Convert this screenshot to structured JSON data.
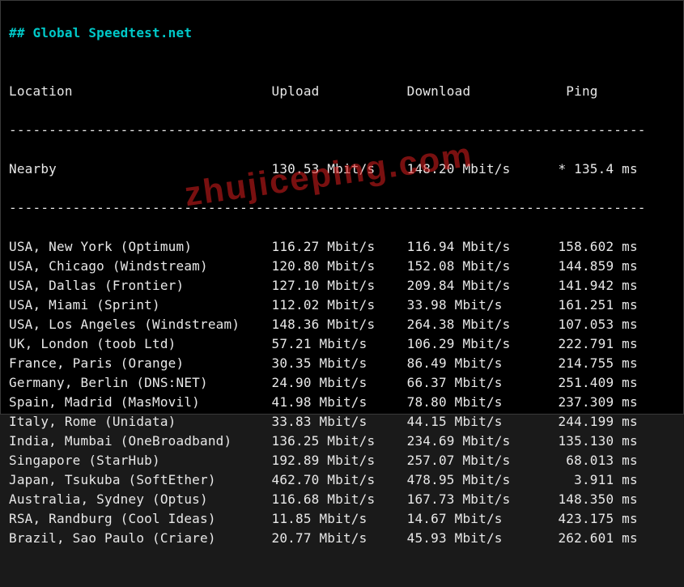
{
  "title": "## Global Speedtest.net",
  "headers": {
    "location": "Location",
    "upload": "Upload",
    "download": "Download",
    "ping": "Ping"
  },
  "separator": "--------------------------------------------------------------------------------",
  "nearby": {
    "location": "Nearby",
    "upload": "130.53 Mbit/s",
    "download": "148.20 Mbit/s",
    "ping": "* 135.4 ms"
  },
  "rows": [
    {
      "location": "USA, New York (Optimum)",
      "upload": "116.27 Mbit/s",
      "download": "116.94 Mbit/s",
      "ping": "158.602 ms"
    },
    {
      "location": "USA, Chicago (Windstream)",
      "upload": "120.80 Mbit/s",
      "download": "152.08 Mbit/s",
      "ping": "144.859 ms"
    },
    {
      "location": "USA, Dallas (Frontier)",
      "upload": "127.10 Mbit/s",
      "download": "209.84 Mbit/s",
      "ping": "141.942 ms"
    },
    {
      "location": "USA, Miami (Sprint)",
      "upload": "112.02 Mbit/s",
      "download": "33.98 Mbit/s",
      "ping": "161.251 ms"
    },
    {
      "location": "USA, Los Angeles (Windstream)",
      "upload": "148.36 Mbit/s",
      "download": "264.38 Mbit/s",
      "ping": "107.053 ms"
    },
    {
      "location": "UK, London (toob Ltd)",
      "upload": "57.21 Mbit/s",
      "download": "106.29 Mbit/s",
      "ping": "222.791 ms"
    },
    {
      "location": "France, Paris (Orange)",
      "upload": "30.35 Mbit/s",
      "download": "86.49 Mbit/s",
      "ping": "214.755 ms"
    },
    {
      "location": "Germany, Berlin (DNS:NET)",
      "upload": "24.90 Mbit/s",
      "download": "66.37 Mbit/s",
      "ping": "251.409 ms"
    },
    {
      "location": "Spain, Madrid (MasMovil)",
      "upload": "41.98 Mbit/s",
      "download": "78.80 Mbit/s",
      "ping": "237.309 ms"
    },
    {
      "location": "Italy, Rome (Unidata)",
      "upload": "33.83 Mbit/s",
      "download": "44.15 Mbit/s",
      "ping": "244.199 ms"
    },
    {
      "location": "India, Mumbai (OneBroadband)",
      "upload": "136.25 Mbit/s",
      "download": "234.69 Mbit/s",
      "ping": "135.130 ms"
    },
    {
      "location": "Singapore (StarHub)",
      "upload": "192.89 Mbit/s",
      "download": "257.07 Mbit/s",
      "ping": "68.013 ms"
    },
    {
      "location": "Japan, Tsukuba (SoftEther)",
      "upload": "462.70 Mbit/s",
      "download": "478.95 Mbit/s",
      "ping": "3.911 ms"
    },
    {
      "location": "Australia, Sydney (Optus)",
      "upload": "116.68 Mbit/s",
      "download": "167.73 Mbit/s",
      "ping": "148.350 ms"
    },
    {
      "location": "RSA, Randburg (Cool Ideas)",
      "upload": "11.85 Mbit/s",
      "download": "14.67 Mbit/s",
      "ping": "423.175 ms"
    },
    {
      "location": "Brazil, Sao Paulo (Criare)",
      "upload": "20.77 Mbit/s",
      "download": "45.93 Mbit/s",
      "ping": "262.601 ms"
    }
  ],
  "watermark": "zhujiceping.com"
}
